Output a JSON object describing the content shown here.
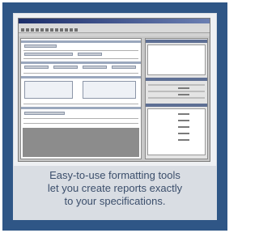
{
  "caption": {
    "line1": "Easy-to-use formatting tools",
    "line2": "let you create reports exactly",
    "line3": "to your specifications."
  },
  "screenshot": {
    "icon": "report-designer-window-thumbnail"
  },
  "colors": {
    "frame": "#2f5686",
    "panel": "#d9dde3",
    "caption_text": "#3b4e6b"
  }
}
